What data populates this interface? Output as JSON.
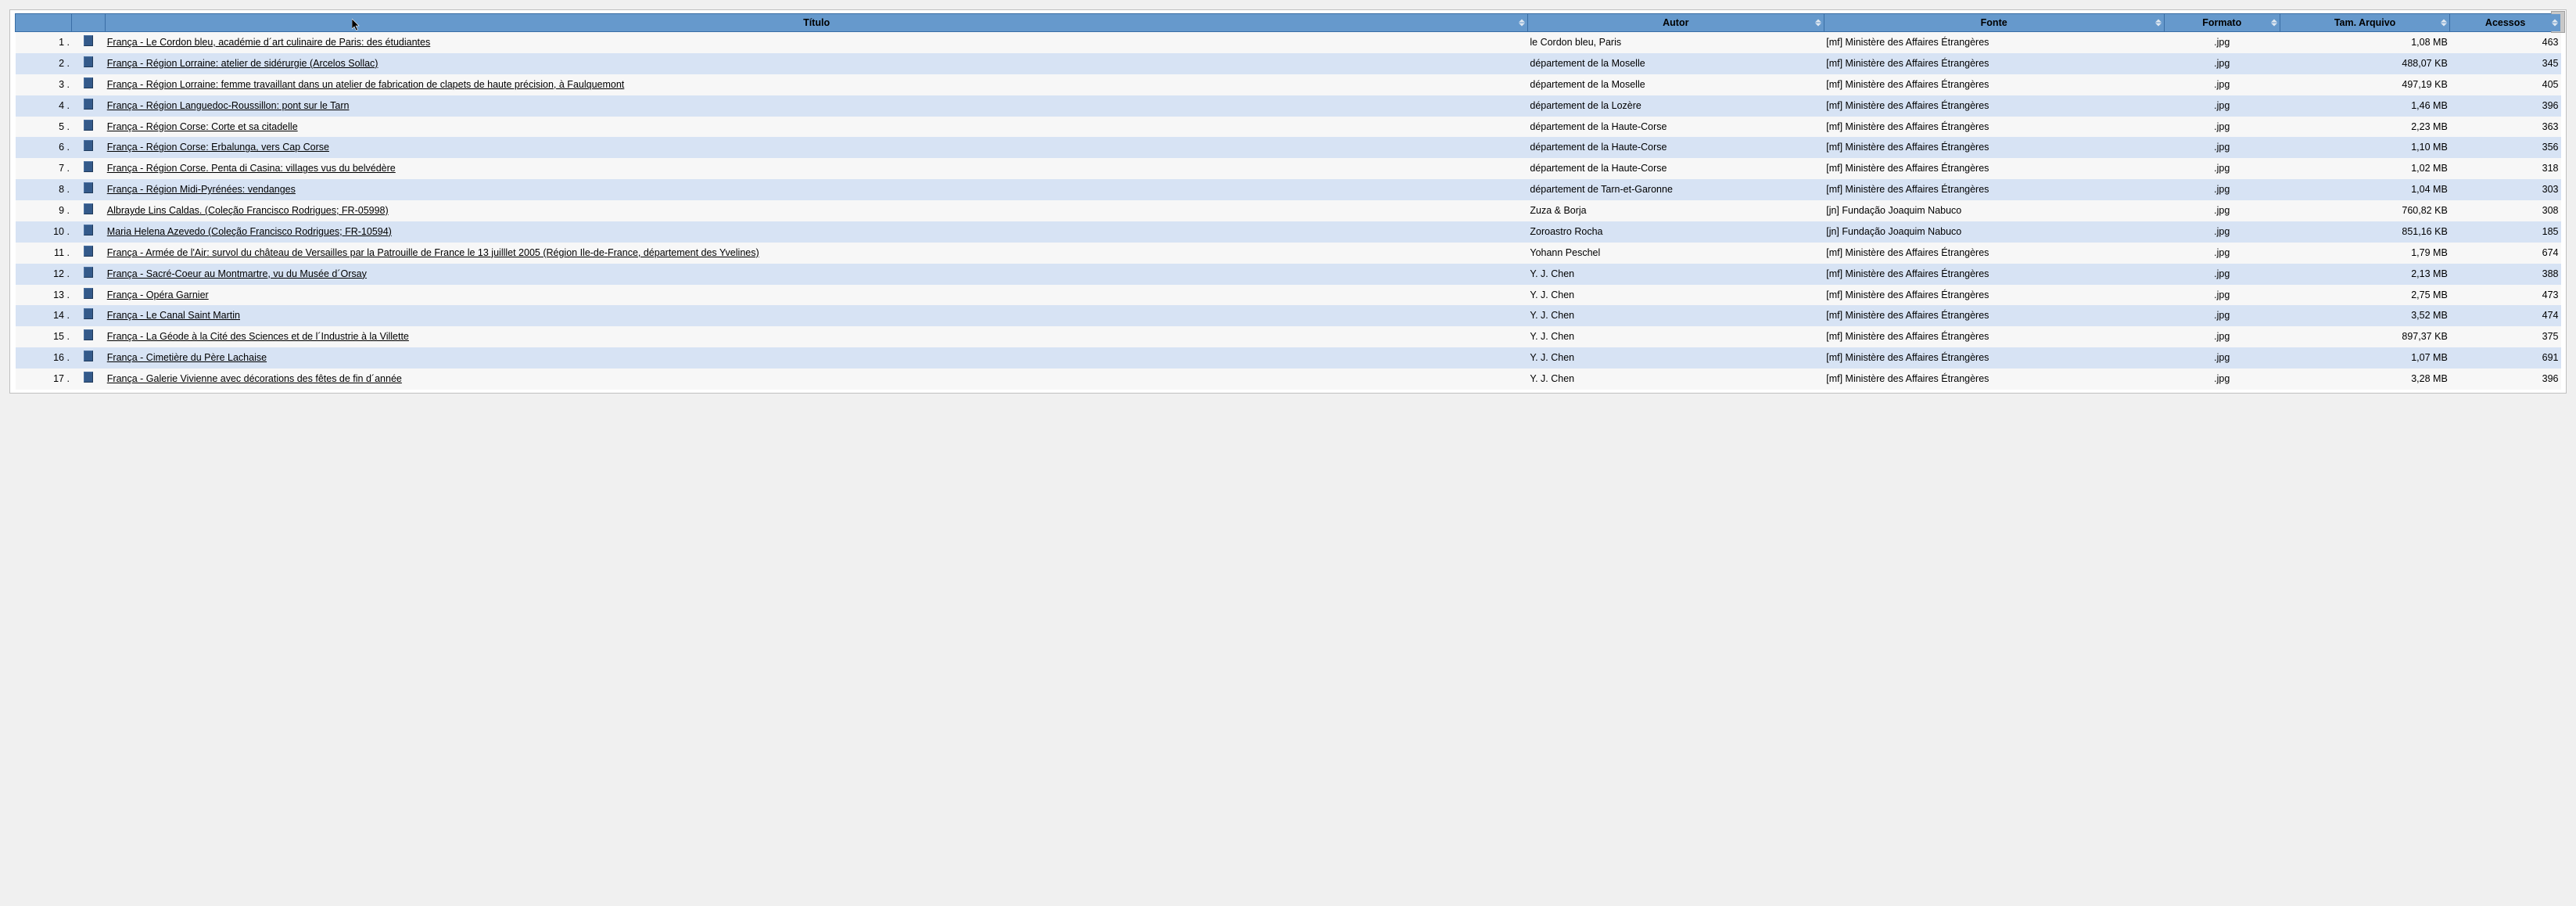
{
  "headers": {
    "idx": "",
    "ico": "",
    "titulo": "Título",
    "autor": "Autor",
    "fonte": "Fonte",
    "formato": "Formato",
    "tamArquivo": "Tam. Arquivo",
    "acessos": "Acessos"
  },
  "rows": [
    {
      "n": "1 .",
      "title": "França - Le Cordon bleu, académie d´art culinaire de Paris: des étudiantes",
      "autor": "le Cordon bleu, Paris",
      "fonte": "[mf] Ministère des Affaires Étrangères",
      "fmt": ".jpg",
      "size": "1,08 MB",
      "acc": "463"
    },
    {
      "n": "2 .",
      "title": "França - Région Lorraine: atelier de sidérurgie (Arcelos Sollac)",
      "autor": "département de la Moselle",
      "fonte": "[mf] Ministère des Affaires Étrangères",
      "fmt": ".jpg",
      "size": "488,07 KB",
      "acc": "345"
    },
    {
      "n": "3 .",
      "title": "França - Région Lorraine: femme travaillant dans un atelier de fabrication de clapets de haute précision, à Faulquemont",
      "autor": "département de la Moselle",
      "fonte": "[mf] Ministère des Affaires Étrangères",
      "fmt": ".jpg",
      "size": "497,19 KB",
      "acc": "405"
    },
    {
      "n": "4 .",
      "title": "França - Région Languedoc-Roussillon: pont sur le Tarn",
      "autor": "département de la Lozère",
      "fonte": "[mf] Ministère des Affaires Étrangères",
      "fmt": ".jpg",
      "size": "1,46 MB",
      "acc": "396"
    },
    {
      "n": "5 .",
      "title": "França - Région Corse: Corte et sa citadelle",
      "autor": "département de la Haute-Corse",
      "fonte": "[mf] Ministère des Affaires Étrangères",
      "fmt": ".jpg",
      "size": "2,23 MB",
      "acc": "363"
    },
    {
      "n": "6 .",
      "title": "França - Région Corse: Erbalunga, vers Cap Corse",
      "autor": "département de la Haute-Corse",
      "fonte": "[mf] Ministère des Affaires Étrangères",
      "fmt": ".jpg",
      "size": "1,10 MB",
      "acc": "356"
    },
    {
      "n": "7 .",
      "title": "França - Région Corse. Penta di Casina: villages vus du belvédère",
      "autor": "département de la Haute-Corse",
      "fonte": "[mf] Ministère des Affaires Étrangères",
      "fmt": ".jpg",
      "size": "1,02 MB",
      "acc": "318"
    },
    {
      "n": "8 .",
      "title": "França - Région Midi-Pyrénées: vendanges",
      "autor": "département de Tarn-et-Garonne",
      "fonte": "[mf] Ministère des Affaires Étrangères",
      "fmt": ".jpg",
      "size": "1,04 MB",
      "acc": "303"
    },
    {
      "n": "9 .",
      "title": "Albrayde Lins Caldas. (Coleção Francisco Rodrigues; FR-05998)",
      "autor": "Zuza & Borja",
      "fonte": "[jn] Fundação Joaquim Nabuco",
      "fmt": ".jpg",
      "size": "760,82 KB",
      "acc": "308"
    },
    {
      "n": "10 .",
      "title": "Maria Helena Azevedo (Coleção Francisco Rodrigues; FR-10594)",
      "autor": "Zoroastro Rocha",
      "fonte": "[jn] Fundação Joaquim Nabuco",
      "fmt": ".jpg",
      "size": "851,16 KB",
      "acc": "185"
    },
    {
      "n": "11 .",
      "title": "França - Armée de l'Air: survol du château de Versailles par la Patrouille de France le 13 juilllet 2005 (Région Ile-de-France, département des Yvelines)",
      "autor": "Yohann Peschel",
      "fonte": "[mf] Ministère des Affaires Étrangères",
      "fmt": ".jpg",
      "size": "1,79 MB",
      "acc": "674"
    },
    {
      "n": "12 .",
      "title": "França - Sacré-Coeur au Montmartre, vu du Musée d´Orsay",
      "autor": "Y. J. Chen",
      "fonte": "[mf] Ministère des Affaires Étrangères",
      "fmt": ".jpg",
      "size": "2,13 MB",
      "acc": "388"
    },
    {
      "n": "13 .",
      "title": "França - Opéra Garnier",
      "autor": "Y. J. Chen",
      "fonte": "[mf] Ministère des Affaires Étrangères",
      "fmt": ".jpg",
      "size": "2,75 MB",
      "acc": "473"
    },
    {
      "n": "14 .",
      "title": "França - Le Canal Saint Martin",
      "autor": "Y. J. Chen",
      "fonte": "[mf] Ministère des Affaires Étrangères",
      "fmt": ".jpg",
      "size": "3,52 MB",
      "acc": "474"
    },
    {
      "n": "15 .",
      "title": "França - La Géode à la Cité des Sciences et de l´Industrie à la Villette",
      "autor": "Y. J. Chen",
      "fonte": "[mf] Ministère des Affaires Étrangères",
      "fmt": ".jpg",
      "size": "897,37 KB",
      "acc": "375"
    },
    {
      "n": "16 .",
      "title": "França - Cimetière du Père Lachaise",
      "autor": "Y. J. Chen",
      "fonte": "[mf] Ministère des Affaires Étrangères",
      "fmt": ".jpg",
      "size": "1,07 MB",
      "acc": "691"
    },
    {
      "n": "17 .",
      "title": "França - Galerie Vivienne avec décorations des fêtes de fin d´année",
      "autor": "Y. J. Chen",
      "fonte": "[mf] Ministère des Affaires Étrangères",
      "fmt": ".jpg",
      "size": "3,28 MB",
      "acc": "396"
    }
  ]
}
